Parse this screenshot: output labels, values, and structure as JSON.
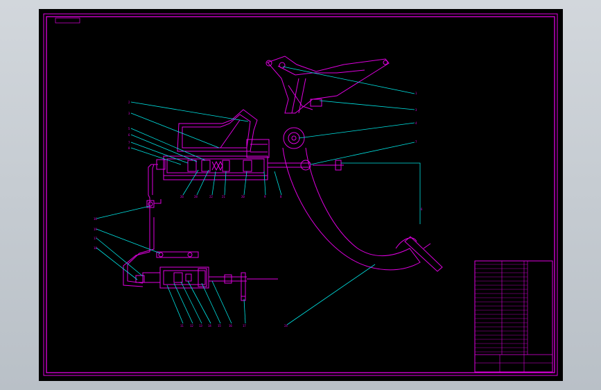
{
  "title_tag": "",
  "colors": {
    "background": "#000000",
    "frame": "#e000e0",
    "leader": "#00e6e6",
    "chrome": "#c7cdd3"
  },
  "part_labels": {
    "upper_right": [
      "1",
      "3",
      "4",
      "7"
    ],
    "upper_left": [
      "2",
      "3",
      "5",
      "6",
      "7",
      "8"
    ],
    "upper_bottom": [
      "26",
      "28",
      "22",
      "21",
      "20",
      "9",
      "8"
    ],
    "lower_left": [
      "16",
      "19",
      "17",
      "18"
    ],
    "lower_bottom": [
      "11",
      "12",
      "13",
      "14",
      "15",
      "16",
      "17"
    ],
    "pedal": "24",
    "vertical_right": "6"
  },
  "notes": {
    "heading": "",
    "lines": [
      "",
      "",
      ""
    ]
  },
  "title_block": {
    "rows": [
      "",
      "",
      "",
      "",
      "",
      "",
      "",
      "",
      "",
      "",
      "",
      "",
      "",
      "",
      "",
      "",
      "",
      "",
      "",
      "",
      "",
      ""
    ],
    "name": "",
    "drawing_no": "",
    "bottom_left": ""
  }
}
